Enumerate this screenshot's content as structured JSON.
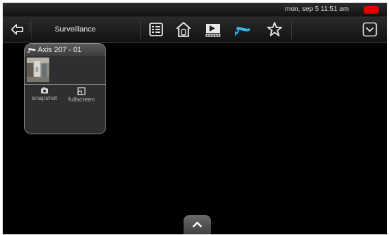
{
  "status": {
    "date_time": "mon, sep 5  11:51 am",
    "battery_color": "#e00000"
  },
  "toolbar": {
    "title": "Surveillance",
    "icons": [
      "back-arrow-icon",
      "list-icon",
      "house-icon",
      "media-icon",
      "camera-icon",
      "star-icon",
      "chevron-down-icon"
    ],
    "active_color": "#36b4ec"
  },
  "card": {
    "title": "Axis 207 - 01",
    "actions": [
      {
        "label": "snapshot"
      },
      {
        "label": "fullscreen"
      }
    ]
  }
}
